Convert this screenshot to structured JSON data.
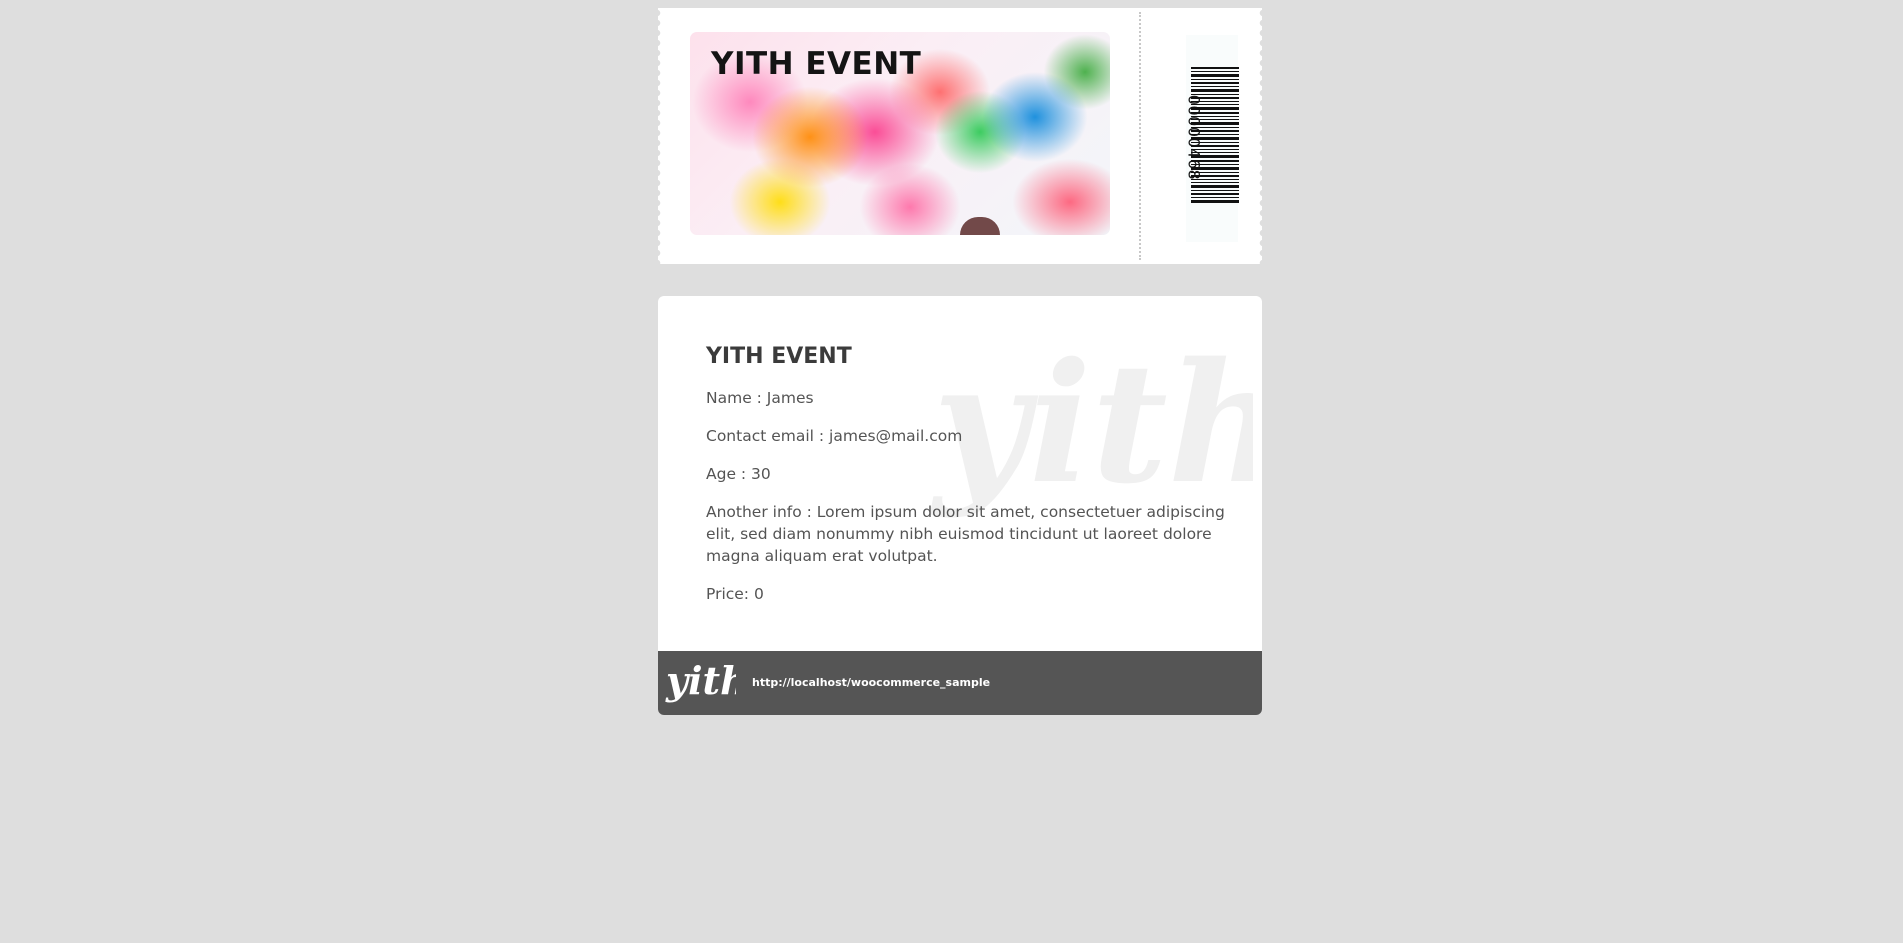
{
  "ticket": {
    "hero_title": "YITH EVENT",
    "barcode_number": "00000468"
  },
  "details": {
    "title": "YITH EVENT",
    "lines": [
      "Name : James",
      "Contact email : james@mail.com",
      "Age : 30",
      "Another info : Lorem ipsum dolor sit amet, consectetuer adipiscing elit, sed diam nonummy nibh euismod tincidunt ut laoreet dolore magna aliquam erat volutpat.",
      "Price: 0"
    ]
  },
  "footer": {
    "logo_text": "yith",
    "url": "http://localhost/woocommerce_sample"
  },
  "watermark_text": "yith",
  "colors": {
    "page_background": "#dedede",
    "card": "#ffffff",
    "footer": "#555555",
    "text": "#545454"
  },
  "icons": {
    "barcode": "barcode-icon",
    "logo": "yith-logo-icon"
  }
}
